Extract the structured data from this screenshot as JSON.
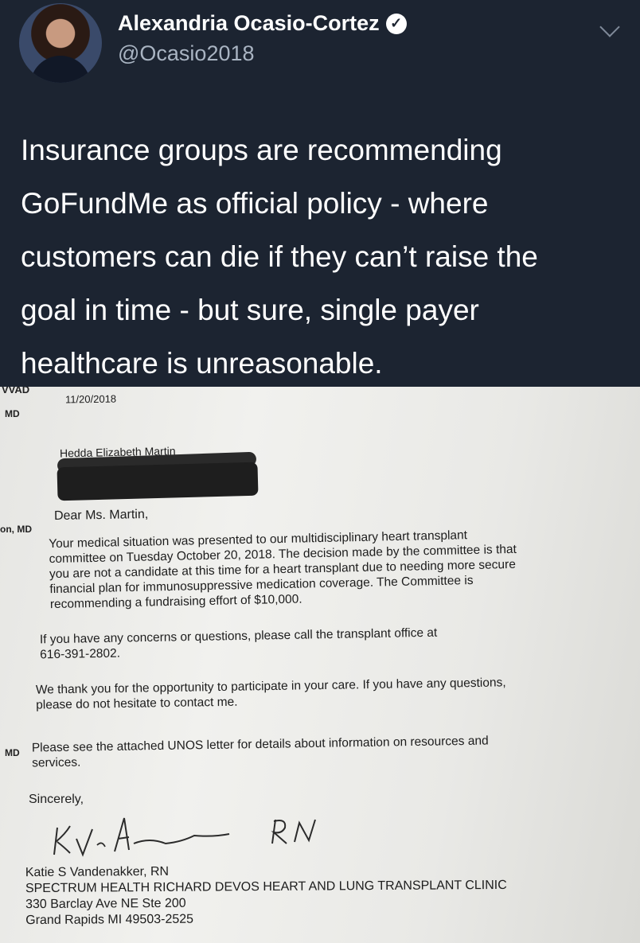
{
  "tweet": {
    "author_name": "Alexandria Ocasio-Cortez",
    "handle": "@Ocasio2018",
    "verified_icon": "verified-check-icon",
    "text_lines": [
      "Insurance groups are recommending",
      "GoFundMe as official policy - where",
      "customers can die if they can’t raise the",
      "goal in time - but sure, single payer",
      "healthcare is unreasonable."
    ]
  },
  "letter": {
    "margin_fragments": [
      "VVAD",
      "MD",
      "on, MD",
      "MD"
    ],
    "date": "11/20/2018",
    "recipient": "Hedda Elizabeth Martin",
    "salutation": "Dear Ms. Martin,",
    "paragraph1": [
      "Your medical situation was presented to our multidisciplinary heart transplant",
      "committee on Tuesday October 20, 2018.  The decision made by the committee is that",
      "you are not a candidate at this time for a heart transplant due to needing more secure",
      "financial plan for immunosuppressive medication coverage.  The Committee is",
      "recommending a fundraising effort of $10,000."
    ],
    "paragraph2": [
      "If you have any concerns or questions, please call the transplant office at",
      "616-391-2802."
    ],
    "paragraph3": [
      "We thank you for the opportunity to participate in your care.  If you have any questions,",
      "please do not hesitate to contact me."
    ],
    "paragraph4": [
      "Please see the attached UNOS letter for details about information on resources and",
      "services."
    ],
    "closing": "Sincerely,",
    "signature_text": "K. V. A— RN",
    "signer_name": "Katie S Vandenakker, RN",
    "clinic": "SPECTRUM HEALTH RICHARD DEVOS HEART AND LUNG TRANSPLANT CLINIC",
    "address_line1": "330 Barclay Ave NE Ste 200",
    "address_line2": "Grand Rapids MI 49503-2525"
  }
}
